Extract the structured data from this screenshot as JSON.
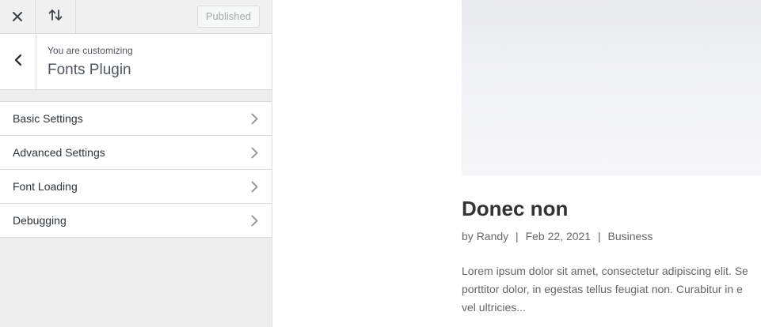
{
  "topbar": {
    "close_icon": "close-icon",
    "reorder_icon": "reorder-arrows-icon",
    "publish_label": "Published"
  },
  "info": {
    "back_icon": "chevron-left-icon",
    "subtitle": "You are customizing",
    "title": "Fonts Plugin"
  },
  "sections": [
    {
      "label": "Basic Settings",
      "icon": "chevron-right-icon"
    },
    {
      "label": "Advanced Settings",
      "icon": "chevron-right-icon"
    },
    {
      "label": "Font Loading",
      "icon": "chevron-right-icon"
    },
    {
      "label": "Debugging",
      "icon": "chevron-right-icon"
    }
  ],
  "preview": {
    "post_title": "Donec non",
    "meta": {
      "prefix": "by",
      "author": "Randy",
      "separator": "|",
      "date": "Feb 22, 2021",
      "category": "Business"
    },
    "excerpt_lines": [
      "Lorem ipsum dolor sit amet, consectetur adipiscing elit. Se",
      "porttitor dolor, in egestas tellus feugiat non. Curabitur in e",
      "vel ultricies..."
    ]
  },
  "colors": {
    "sidebar_bg": "#eeeeee",
    "border": "#dcdcde",
    "text_dark": "#2c3338",
    "text_muted": "#666666"
  }
}
